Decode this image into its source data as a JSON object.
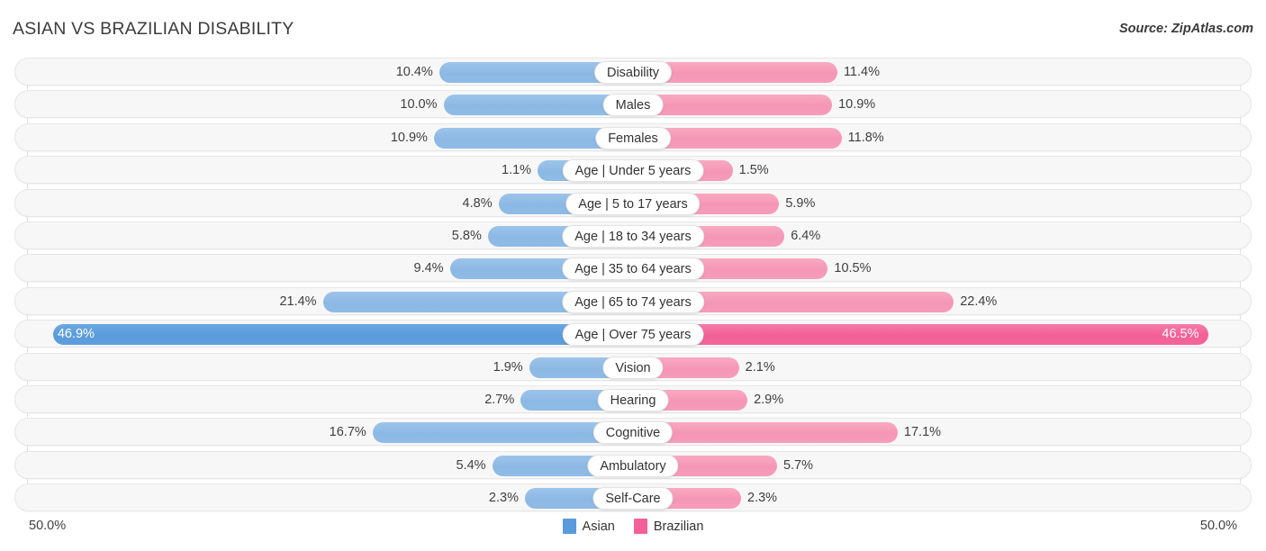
{
  "header": {
    "title": "ASIAN VS BRAZILIAN DISABILITY",
    "source": "Source: ZipAtlas.com"
  },
  "axis": {
    "left_label": "50.0%",
    "right_label": "50.0%"
  },
  "legend": {
    "items": [
      {
        "label": "Asian",
        "color": "#5b9bdb"
      },
      {
        "label": "Brazilian",
        "color": "#f2609a"
      }
    ]
  },
  "chart_data": {
    "type": "bar",
    "title": "ASIAN VS BRAZILIAN DISABILITY",
    "subtitle": "Source: ZipAtlas.com",
    "orientation": "horizontal-diverging",
    "xlabel": "",
    "ylabel": "",
    "xlim": [
      -50.0,
      50.0
    ],
    "axis_left_label": "50.0%",
    "axis_right_label": "50.0%",
    "grid": true,
    "legend_position": "bottom-center",
    "categories": [
      "Disability",
      "Males",
      "Females",
      "Age | Under 5 years",
      "Age | 5 to 17 years",
      "Age | 18 to 34 years",
      "Age | 35 to 64 years",
      "Age | 65 to 74 years",
      "Age | Over 75 years",
      "Vision",
      "Hearing",
      "Cognitive",
      "Ambulatory",
      "Self-Care"
    ],
    "series": [
      {
        "name": "Asian",
        "color": "#8cb8e4",
        "values": [
          10.4,
          10.0,
          10.9,
          1.1,
          4.8,
          5.8,
          9.4,
          21.4,
          46.9,
          1.9,
          2.7,
          16.7,
          5.4,
          2.3
        ],
        "labels": [
          "10.4%",
          "10.0%",
          "10.9%",
          "1.1%",
          "4.8%",
          "5.8%",
          "9.4%",
          "21.4%",
          "46.9%",
          "1.9%",
          "2.7%",
          "16.7%",
          "5.4%",
          "2.3%"
        ]
      },
      {
        "name": "Brazilian",
        "color": "#f596b6",
        "values": [
          11.4,
          10.9,
          11.8,
          1.5,
          5.9,
          6.4,
          10.5,
          22.4,
          46.5,
          2.1,
          2.9,
          17.1,
          5.7,
          2.3
        ],
        "labels": [
          "11.4%",
          "10.9%",
          "11.8%",
          "1.5%",
          "5.9%",
          "6.4%",
          "10.5%",
          "22.4%",
          "46.5%",
          "2.1%",
          "2.9%",
          "17.1%",
          "5.7%",
          "2.3%"
        ]
      }
    ],
    "rows": [
      {
        "label": "Disability",
        "left_value": 10.4,
        "left_label": "10.4%",
        "right_value": 11.4,
        "right_label": "11.4%",
        "highlight": false
      },
      {
        "label": "Males",
        "left_value": 10.0,
        "left_label": "10.0%",
        "right_value": 10.9,
        "right_label": "10.9%",
        "highlight": false
      },
      {
        "label": "Females",
        "left_value": 10.9,
        "left_label": "10.9%",
        "right_value": 11.8,
        "right_label": "11.8%",
        "highlight": false
      },
      {
        "label": "Age | Under 5 years",
        "left_value": 1.1,
        "left_label": "1.1%",
        "right_value": 1.5,
        "right_label": "1.5%",
        "highlight": false
      },
      {
        "label": "Age | 5 to 17 years",
        "left_value": 4.8,
        "left_label": "4.8%",
        "right_value": 5.9,
        "right_label": "5.9%",
        "highlight": false
      },
      {
        "label": "Age | 18 to 34 years",
        "left_value": 5.8,
        "left_label": "5.8%",
        "right_value": 6.4,
        "right_label": "6.4%",
        "highlight": false
      },
      {
        "label": "Age | 35 to 64 years",
        "left_value": 9.4,
        "left_label": "9.4%",
        "right_value": 10.5,
        "right_label": "10.5%",
        "highlight": false
      },
      {
        "label": "Age | 65 to 74 years",
        "left_value": 21.4,
        "left_label": "21.4%",
        "right_value": 22.4,
        "right_label": "22.4%",
        "highlight": false
      },
      {
        "label": "Age | Over 75 years",
        "left_value": 46.9,
        "left_label": "46.9%",
        "right_value": 46.5,
        "right_label": "46.5%",
        "highlight": true
      },
      {
        "label": "Vision",
        "left_value": 1.9,
        "left_label": "1.9%",
        "right_value": 2.1,
        "right_label": "2.1%",
        "highlight": false
      },
      {
        "label": "Hearing",
        "left_value": 2.7,
        "left_label": "2.7%",
        "right_value": 2.9,
        "right_label": "2.9%",
        "highlight": false
      },
      {
        "label": "Cognitive",
        "left_value": 16.7,
        "left_label": "16.7%",
        "right_value": 17.1,
        "right_label": "17.1%",
        "highlight": false
      },
      {
        "label": "Ambulatory",
        "left_value": 5.4,
        "left_label": "5.4%",
        "right_value": 5.7,
        "right_label": "5.7%",
        "highlight": false
      },
      {
        "label": "Self-Care",
        "left_value": 2.3,
        "left_label": "2.3%",
        "right_value": 2.3,
        "right_label": "2.3%",
        "highlight": false
      }
    ]
  }
}
